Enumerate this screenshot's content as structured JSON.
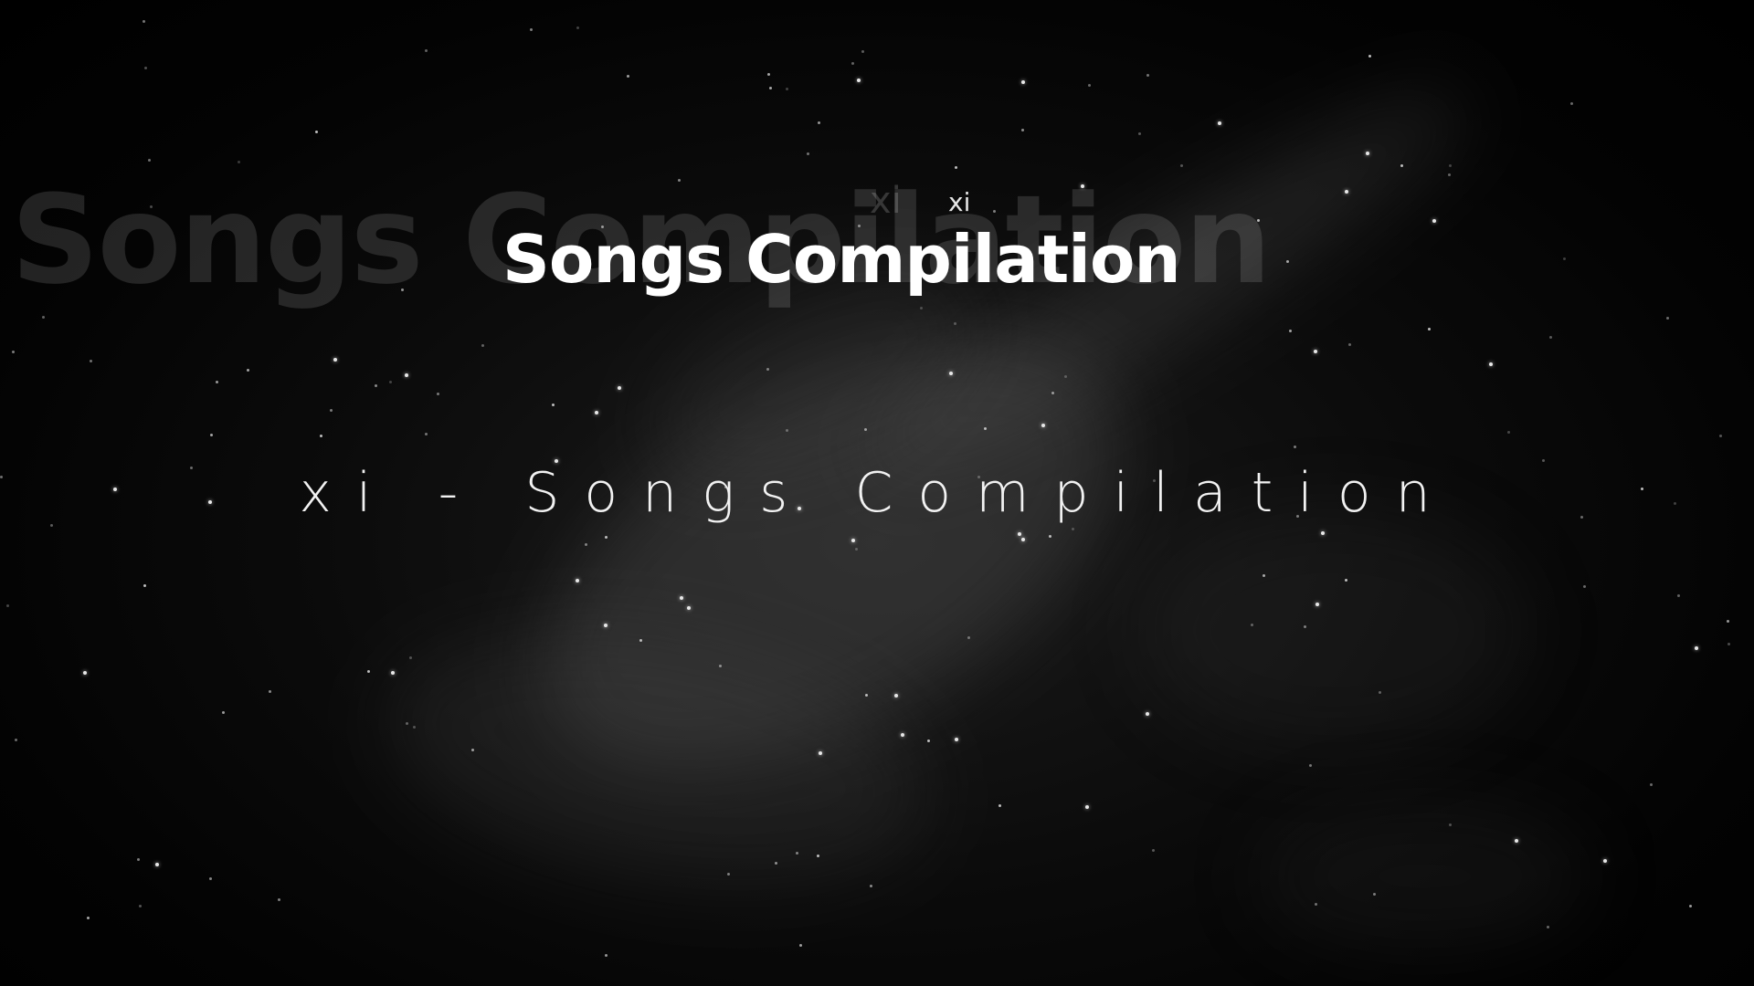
{
  "background": {
    "color": "#000000",
    "description_icon": "nebula-starfield-background"
  },
  "ghost_title": "Songs Compilation",
  "ghost_artist": "xi",
  "artist": "xi",
  "title": "Songs Compilation",
  "subtitle": "xi - Songs Compilation",
  "colors": {
    "text": "#ffffff",
    "ghost_text": "#ffffff"
  }
}
